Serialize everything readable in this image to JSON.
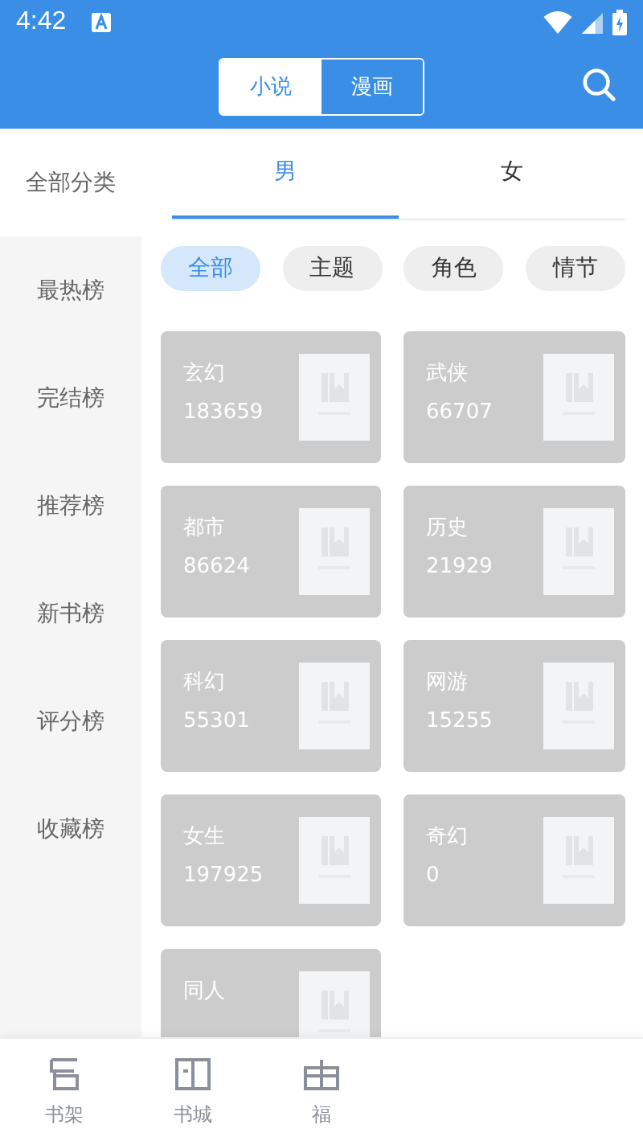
{
  "status_bar": {
    "time": "4:42"
  },
  "header": {
    "segments": [
      {
        "label": "小说",
        "selected": true
      },
      {
        "label": "漫画",
        "selected": false
      }
    ]
  },
  "sidebar": {
    "title": "全部分类",
    "items": [
      {
        "label": "最热榜",
        "selected": false
      },
      {
        "label": "完结榜",
        "selected": false
      },
      {
        "label": "推荐榜",
        "selected": false
      },
      {
        "label": "新书榜",
        "selected": false
      },
      {
        "label": "评分榜",
        "selected": false
      },
      {
        "label": "收藏榜",
        "selected": false
      }
    ]
  },
  "gender_tabs": [
    {
      "label": "男",
      "selected": true
    },
    {
      "label": "女",
      "selected": false
    }
  ],
  "filters": [
    {
      "label": "全部",
      "selected": true
    },
    {
      "label": "主题",
      "selected": false
    },
    {
      "label": "角色",
      "selected": false
    },
    {
      "label": "情节",
      "selected": false
    }
  ],
  "categories": [
    {
      "name": "玄幻",
      "count": "183659"
    },
    {
      "name": "武侠",
      "count": "66707"
    },
    {
      "name": "都市",
      "count": "86624"
    },
    {
      "name": "历史",
      "count": "21929"
    },
    {
      "name": "科幻",
      "count": "55301"
    },
    {
      "name": "网游",
      "count": "15255"
    },
    {
      "name": "女生",
      "count": "197925"
    },
    {
      "name": "奇幻",
      "count": "0"
    },
    {
      "name": "同人"
    }
  ],
  "bottom_nav": [
    {
      "label": "书架",
      "kind": "shelf"
    },
    {
      "label": "书城",
      "kind": "book"
    },
    {
      "label": "福",
      "kind": "gift"
    }
  ]
}
